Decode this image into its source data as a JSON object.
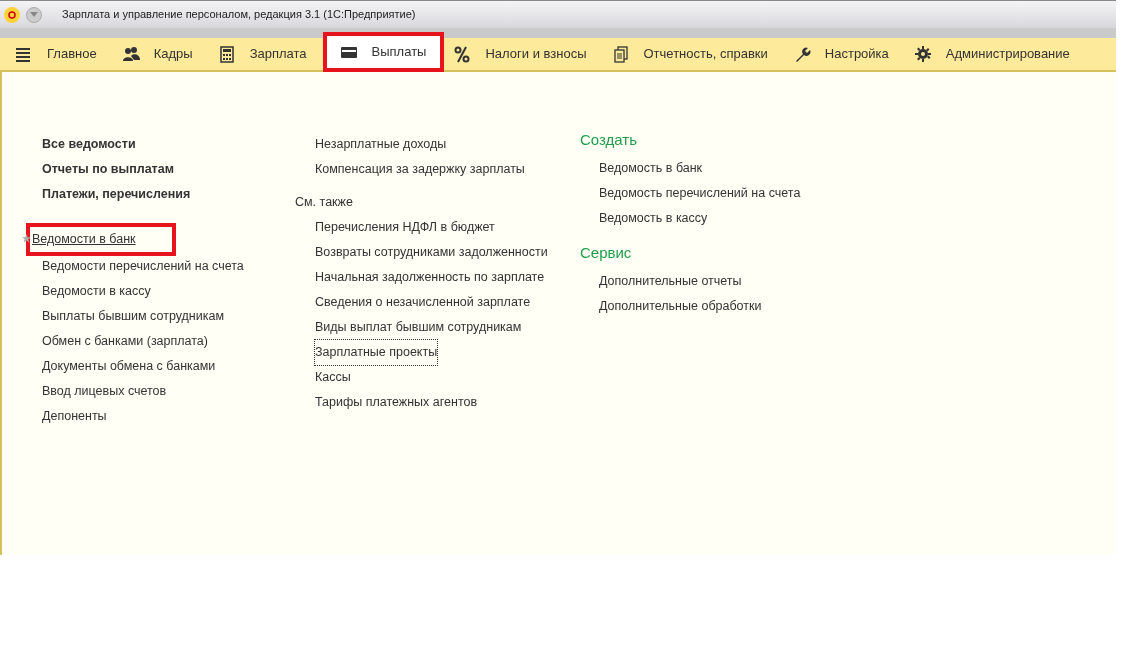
{
  "window": {
    "title": "Зарплата и управление персоналом, редакция 3.1  (1С:Предприятие)"
  },
  "sections": [
    {
      "kind": "menu",
      "label": "Главное",
      "selected": false,
      "highlighted": false
    },
    {
      "kind": "people",
      "label": "Кадры",
      "selected": false,
      "highlighted": false
    },
    {
      "kind": "calculator",
      "label": "Зарплата",
      "selected": false,
      "highlighted": false
    },
    {
      "kind": "card",
      "label": "Выплаты",
      "selected": true,
      "highlighted": true
    },
    {
      "kind": "percent",
      "label": "Налоги и взносы",
      "selected": false,
      "highlighted": false
    },
    {
      "kind": "documents",
      "label": "Отчетность, справки",
      "selected": false,
      "highlighted": false
    },
    {
      "kind": "wrench",
      "label": "Настройка",
      "selected": false,
      "highlighted": false
    },
    {
      "kind": "gear",
      "label": "Администрирование",
      "selected": false,
      "highlighted": false
    }
  ],
  "column_1": {
    "main_links": [
      "Все ведомости",
      "Отчеты по выплатам",
      "Платежи, перечисления"
    ],
    "links": [
      {
        "label": "Ведомости в банк",
        "favorite": true,
        "highlighted": true
      },
      {
        "label": "Ведомости перечислений на счета",
        "favorite": false,
        "highlighted": false
      },
      {
        "label": "Ведомости в кассу",
        "favorite": false,
        "highlighted": false
      },
      {
        "label": "Выплаты бывшим сотрудникам",
        "favorite": false,
        "highlighted": false
      },
      {
        "label": "Обмен с банками (зарплата)",
        "favorite": false,
        "highlighted": false
      },
      {
        "label": "Документы обмена с банками",
        "favorite": false,
        "highlighted": false
      },
      {
        "label": "Ввод лицевых счетов",
        "favorite": false,
        "highlighted": false
      },
      {
        "label": "Депоненты",
        "favorite": false,
        "highlighted": false
      }
    ]
  },
  "column_2": {
    "links": [
      "Незарплатные доходы",
      "Компенсация за задержку зарплаты"
    ],
    "see_also": {
      "title": "См. также",
      "links": [
        {
          "label": "Перечисления НДФЛ в бюджет",
          "focused": false
        },
        {
          "label": "Возвраты сотрудниками задолженности",
          "focused": false
        },
        {
          "label": "Начальная задолженность по зарплате",
          "focused": false
        },
        {
          "label": "Сведения о незачисленной зарплате",
          "focused": false
        },
        {
          "label": "Виды выплат бывшим сотрудникам",
          "focused": false
        },
        {
          "label": "Зарплатные проекты",
          "focused": true
        },
        {
          "label": "Кассы",
          "focused": false
        },
        {
          "label": "Тарифы платежных агентов",
          "focused": false
        }
      ]
    }
  },
  "column_3": [
    {
      "title": "Создать",
      "links": [
        "Ведомость в банк",
        "Ведомость перечислений на счета",
        "Ведомость в кассу"
      ]
    },
    {
      "title": "Сервис",
      "links": [
        "Дополнительные отчеты",
        "Дополнительные обработки"
      ]
    }
  ]
}
